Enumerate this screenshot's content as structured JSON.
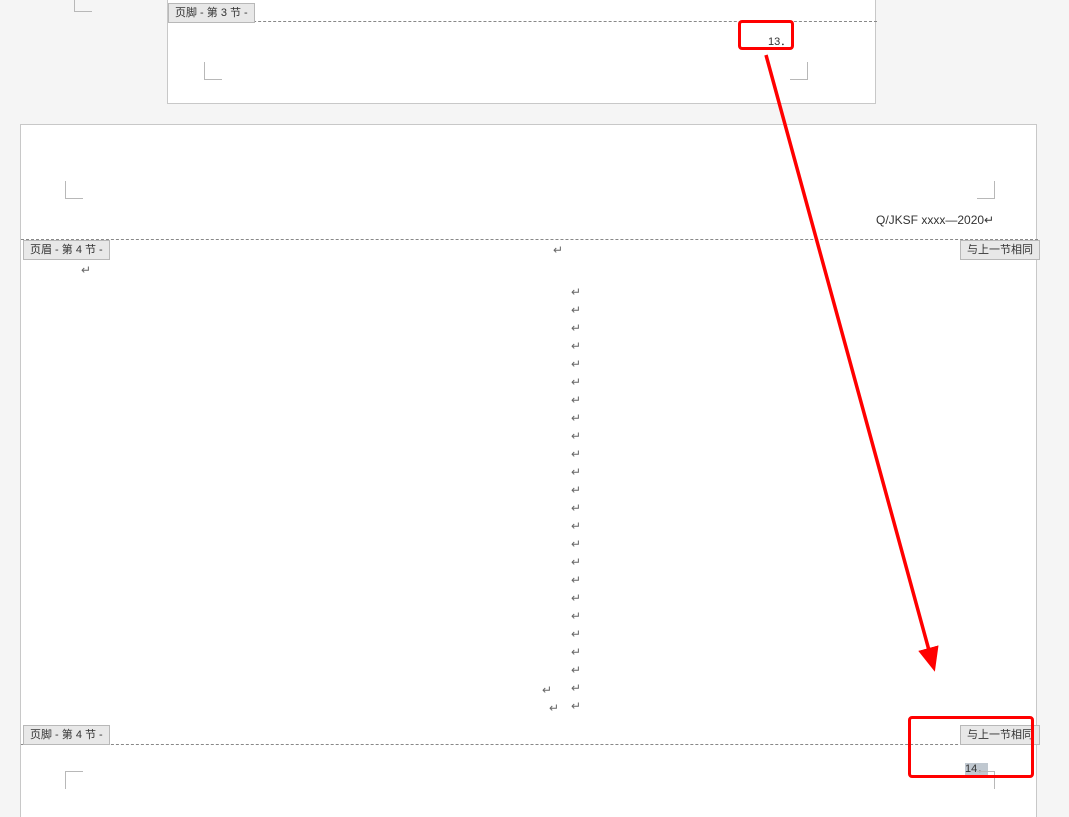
{
  "page1": {
    "footer_tag": "页脚 - 第 3 节 -",
    "page_number": "13"
  },
  "page2": {
    "header_tag_left": "页眉 - 第 4 节 -",
    "header_tag_right": "与上一节相同",
    "header_text": "Q/JKSF xxxx—2020",
    "footer_tag_left": "页脚 - 第 4 节 -",
    "footer_tag_right": "与上一节相同",
    "page_number_a": "14"
  },
  "glyphs": {
    "para": "↵",
    "para_suffix": "．",
    "enter": "↵"
  },
  "annotation": {
    "arrow_color": "#ff0000"
  }
}
